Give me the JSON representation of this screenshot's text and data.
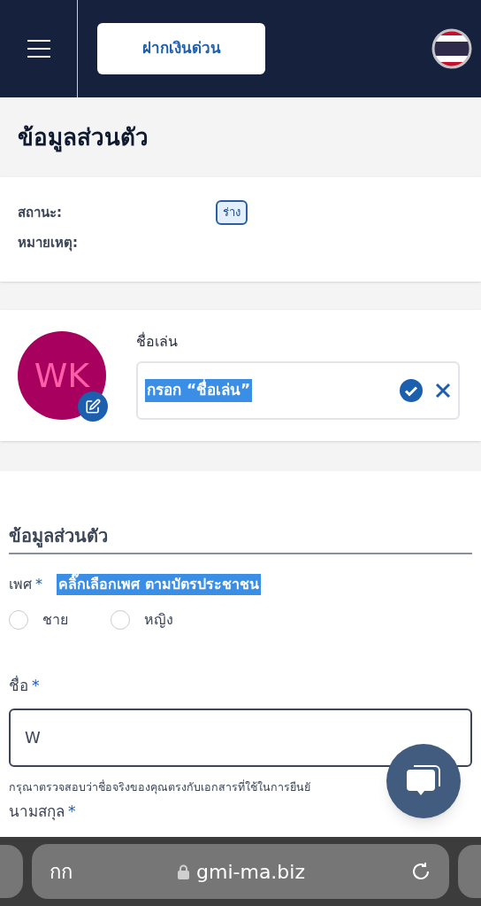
{
  "header": {
    "deposit_button": "ฝากเงินด่วน"
  },
  "page_title": "ข้อมูลส่วนตัว",
  "status_card": {
    "rows": [
      {
        "label": "สถานะ:",
        "badge": "ร่าง"
      },
      {
        "label": "หมายเหตุ:"
      }
    ]
  },
  "profile": {
    "avatar_initials": "WK",
    "nickname_label": "ชื่อเล่น",
    "nickname_value": "กรอก “ชื่อเล่น”",
    "nickname_highlighted": true
  },
  "form": {
    "section_title": "ข้อมูลส่วนตัว",
    "gender": {
      "label": "เพศ",
      "required_mark": "*",
      "hint": "คลิ๊กเลือกเพศ ตามบัตรประชาชน",
      "hint_highlighted": true,
      "options": [
        {
          "label": "ชาย",
          "selected": false
        },
        {
          "label": "หญิง",
          "selected": false
        }
      ]
    },
    "first_name": {
      "label": "ชื่อ",
      "required_mark": "*",
      "value": "W",
      "help": "กรุณาตรวจสอบว่าชื่อจริงของคุณตรงกับเอกสารที่ใช้ในการยืนยั"
    },
    "last_name": {
      "label": "นามสกุล",
      "required_mark": "*"
    }
  },
  "browser": {
    "text_size": "กก",
    "url": "gmi-ma.biz"
  }
}
